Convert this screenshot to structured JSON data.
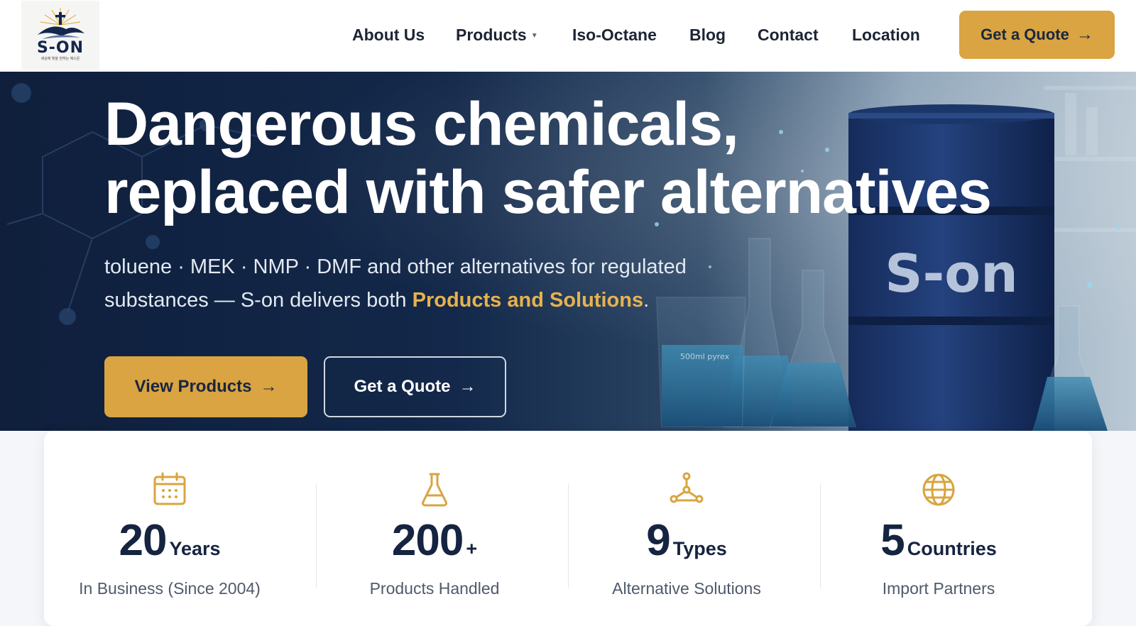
{
  "brand": {
    "logo_text": "S-ON",
    "logo_tagline": "세상에 빛을 전하는 에스온"
  },
  "nav": {
    "items": [
      {
        "label": "About Us"
      },
      {
        "label": "Products",
        "has_dropdown": true
      },
      {
        "label": "Iso-Octane"
      },
      {
        "label": "Blog"
      },
      {
        "label": "Contact"
      },
      {
        "label": "Location"
      }
    ],
    "cta_label": "Get a Quote",
    "caret_icon": "caret-down-icon",
    "arrow_icon": "arrow-right-icon"
  },
  "hero": {
    "title_line1": "Dangerous chemicals,",
    "title_line2": "replaced with safer alternatives",
    "subtitle_prefix": "toluene · MEK · NMP · DMF and other alternatives for regulated substances — S-on delivers both ",
    "subtitle_highlight": "Products and Solutions",
    "subtitle_suffix": ".",
    "primary_button": "View Products",
    "secondary_button": "Get a Quote",
    "drum_brand": "S-on",
    "beaker_label": "500ml pyrex"
  },
  "stats": [
    {
      "icon": "calendar-icon",
      "number": "20",
      "unit": "Years",
      "label": "In Business (Since 2004)"
    },
    {
      "icon": "flask-icon",
      "number": "200",
      "unit": "+",
      "label": "Products Handled"
    },
    {
      "icon": "network-icon",
      "number": "9",
      "unit": "Types",
      "label": "Alternative Solutions"
    },
    {
      "icon": "globe-icon",
      "number": "5",
      "unit": "Countries",
      "label": "Import Partners"
    }
  ],
  "colors": {
    "accent_gold": "#d9a441",
    "navy": "#13264d",
    "hero_dark": "#0f1f3c"
  }
}
